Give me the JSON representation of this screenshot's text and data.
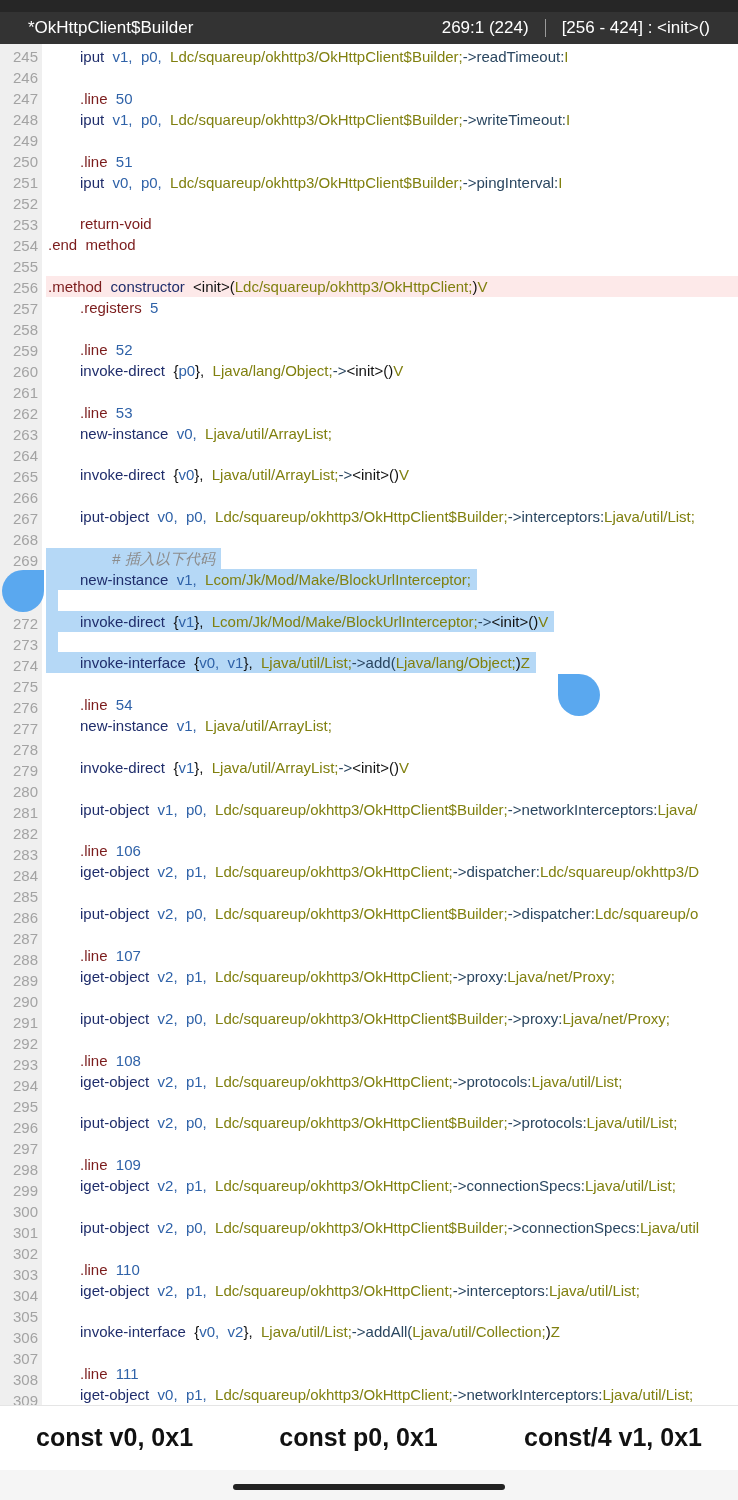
{
  "header": {
    "title": "*OkHttpClient$Builder",
    "position": "269:1 (224)",
    "range": "[256 - 424] : <init>()"
  },
  "lines": [
    {
      "number": "245",
      "kind": "code",
      "selected": false,
      "current": false,
      "tokens": [
        {
          "kind": "op",
          "text": "iput"
        },
        {
          "kind": "reg",
          "text": "  v1,"
        },
        {
          "kind": "reg",
          "text": "  p0,"
        },
        {
          "kind": "cls",
          "text": "  Ldc/squareup/okhttp3/OkHttpClient$Builder;"
        },
        {
          "kind": "mem",
          "text": "->readTimeout:"
        },
        {
          "kind": "cls",
          "text": "I"
        }
      ]
    },
    {
      "number": "246",
      "kind": "blank",
      "selected": false,
      "current": false
    },
    {
      "number": "247",
      "kind": "code",
      "selected": false,
      "current": false,
      "tokens": [
        {
          "kind": "dir",
          "text": ".line"
        },
        {
          "kind": "num",
          "text": "  50"
        }
      ]
    },
    {
      "number": "248",
      "kind": "code",
      "selected": false,
      "current": false,
      "tokens": [
        {
          "kind": "op",
          "text": "iput"
        },
        {
          "kind": "reg",
          "text": "  v1,"
        },
        {
          "kind": "reg",
          "text": "  p0,"
        },
        {
          "kind": "cls",
          "text": "  Ldc/squareup/okhttp3/OkHttpClient$Builder;"
        },
        {
          "kind": "mem",
          "text": "->writeTimeout:"
        },
        {
          "kind": "cls",
          "text": "I"
        }
      ]
    },
    {
      "number": "249",
      "kind": "blank",
      "selected": false,
      "current": false
    },
    {
      "number": "250",
      "kind": "code",
      "selected": false,
      "current": false,
      "tokens": [
        {
          "kind": "dir",
          "text": ".line"
        },
        {
          "kind": "num",
          "text": "  51"
        }
      ]
    },
    {
      "number": "251",
      "kind": "code",
      "selected": false,
      "current": false,
      "tokens": [
        {
          "kind": "op",
          "text": "iput"
        },
        {
          "kind": "reg",
          "text": "  v0,"
        },
        {
          "kind": "reg",
          "text": "  p0,"
        },
        {
          "kind": "cls",
          "text": "  Ldc/squareup/okhttp3/OkHttpClient$Builder;"
        },
        {
          "kind": "mem",
          "text": "->pingInterval:"
        },
        {
          "kind": "cls",
          "text": "I"
        }
      ]
    },
    {
      "number": "252",
      "kind": "blank",
      "selected": false,
      "current": false
    },
    {
      "number": "253",
      "kind": "code",
      "selected": false,
      "current": false,
      "tokens": [
        {
          "kind": "dir",
          "text": "return-void"
        }
      ]
    },
    {
      "number": "254",
      "kind": "decl",
      "selected": false,
      "current": false,
      "tokens": [
        {
          "kind": "dir",
          "text": ".end  method"
        }
      ]
    },
    {
      "number": "255",
      "kind": "blank",
      "selected": false,
      "current": false
    },
    {
      "number": "256",
      "kind": "decl",
      "selected": false,
      "current": true,
      "tokens": [
        {
          "kind": "dir",
          "text": ".method"
        },
        {
          "kind": "op",
          "text": "  constructor"
        },
        {
          "kind": "txt",
          "text": "  <init>("
        },
        {
          "kind": "cls",
          "text": "Ldc/squareup/okhttp3/OkHttpClient;"
        },
        {
          "kind": "txt",
          "text": ")"
        },
        {
          "kind": "cls",
          "text": "V"
        }
      ]
    },
    {
      "number": "257",
      "kind": "code",
      "selected": false,
      "current": false,
      "tokens": [
        {
          "kind": "dir",
          "text": ".registers"
        },
        {
          "kind": "num",
          "text": "  5"
        }
      ]
    },
    {
      "number": "258",
      "kind": "blank",
      "selected": false,
      "current": false
    },
    {
      "number": "259",
      "kind": "code",
      "selected": false,
      "current": false,
      "tokens": [
        {
          "kind": "dir",
          "text": ".line"
        },
        {
          "kind": "num",
          "text": "  52"
        }
      ]
    },
    {
      "number": "260",
      "kind": "code",
      "selected": false,
      "current": false,
      "tokens": [
        {
          "kind": "op",
          "text": "invoke-direct"
        },
        {
          "kind": "txt",
          "text": "  {"
        },
        {
          "kind": "reg",
          "text": "p0"
        },
        {
          "kind": "txt",
          "text": "},"
        },
        {
          "kind": "cls",
          "text": "  Ljava/lang/Object;"
        },
        {
          "kind": "mem",
          "text": "->"
        },
        {
          "kind": "txt",
          "text": "<init>()"
        },
        {
          "kind": "cls",
          "text": "V"
        }
      ]
    },
    {
      "number": "261",
      "kind": "blank",
      "selected": false,
      "current": false
    },
    {
      "number": "262",
      "kind": "code",
      "selected": false,
      "current": false,
      "tokens": [
        {
          "kind": "dir",
          "text": ".line"
        },
        {
          "kind": "num",
          "text": "  53"
        }
      ]
    },
    {
      "number": "263",
      "kind": "code",
      "selected": false,
      "current": false,
      "tokens": [
        {
          "kind": "op",
          "text": "new-instance"
        },
        {
          "kind": "reg",
          "text": "  v0,"
        },
        {
          "kind": "cls",
          "text": "  Ljava/util/ArrayList;"
        }
      ]
    },
    {
      "number": "264",
      "kind": "blank",
      "selected": false,
      "current": false
    },
    {
      "number": "265",
      "kind": "code",
      "selected": false,
      "current": false,
      "tokens": [
        {
          "kind": "op",
          "text": "invoke-direct"
        },
        {
          "kind": "txt",
          "text": "  {"
        },
        {
          "kind": "reg",
          "text": "v0"
        },
        {
          "kind": "txt",
          "text": "},"
        },
        {
          "kind": "cls",
          "text": "  Ljava/util/ArrayList;"
        },
        {
          "kind": "mem",
          "text": "->"
        },
        {
          "kind": "txt",
          "text": "<init>()"
        },
        {
          "kind": "cls",
          "text": "V"
        }
      ]
    },
    {
      "number": "266",
      "kind": "blank",
      "selected": false,
      "current": false
    },
    {
      "number": "267",
      "kind": "code",
      "selected": false,
      "current": false,
      "tokens": [
        {
          "kind": "op",
          "text": "iput-object"
        },
        {
          "kind": "reg",
          "text": "  v0,"
        },
        {
          "kind": "reg",
          "text": "  p0,"
        },
        {
          "kind": "cls",
          "text": "  Ldc/squareup/okhttp3/OkHttpClient$Builder;"
        },
        {
          "kind": "mem",
          "text": "->interceptors:"
        },
        {
          "kind": "cls",
          "text": "Ljava/util/List;"
        }
      ]
    },
    {
      "number": "268",
      "kind": "blank",
      "selected": false,
      "current": false
    },
    {
      "number": "269",
      "kind": "comment",
      "selected": true,
      "current": false,
      "tokens": [
        {
          "kind": "cmt",
          "text": "# 插入以下代码"
        }
      ]
    },
    {
      "kind": "code",
      "selected": true,
      "current": false,
      "tokens": [
        {
          "kind": "op",
          "text": "new-instance"
        },
        {
          "kind": "reg",
          "text": "  v1,"
        },
        {
          "kind": "cls",
          "text": "  Lcom/Jk/Mod/Make/BlockUrlInterceptor;"
        }
      ]
    },
    {
      "kind": "blank",
      "selected": true,
      "current": false
    },
    {
      "number": "272",
      "kind": "code",
      "selected": true,
      "current": false,
      "tokens": [
        {
          "kind": "op",
          "text": "invoke-direct"
        },
        {
          "kind": "txt",
          "text": "  {"
        },
        {
          "kind": "reg",
          "text": "v1"
        },
        {
          "kind": "txt",
          "text": "},"
        },
        {
          "kind": "cls",
          "text": "  Lcom/Jk/Mod/Make/BlockUrlInterceptor;"
        },
        {
          "kind": "mem",
          "text": "->"
        },
        {
          "kind": "txt",
          "text": "<init>()"
        },
        {
          "kind": "cls",
          "text": "V"
        }
      ]
    },
    {
      "number": "273",
      "kind": "blank",
      "selected": true,
      "current": false
    },
    {
      "number": "274",
      "kind": "code",
      "selected": true,
      "current": false,
      "tokens": [
        {
          "kind": "op",
          "text": "invoke-interface"
        },
        {
          "kind": "txt",
          "text": "  {"
        },
        {
          "kind": "reg",
          "text": "v0,"
        },
        {
          "kind": "reg",
          "text": "  v1"
        },
        {
          "kind": "txt",
          "text": "},"
        },
        {
          "kind": "cls",
          "text": "  Ljava/util/List;"
        },
        {
          "kind": "mem",
          "text": "->add("
        },
        {
          "kind": "cls",
          "text": "Ljava/lang/Object;"
        },
        {
          "kind": "txt",
          "text": ")"
        },
        {
          "kind": "cls",
          "text": "Z"
        }
      ]
    },
    {
      "number": "275",
      "kind": "blank",
      "selected": false,
      "current": false
    },
    {
      "number": "276",
      "kind": "code",
      "selected": false,
      "current": false,
      "tokens": [
        {
          "kind": "dir",
          "text": ".line"
        },
        {
          "kind": "num",
          "text": "  54"
        }
      ]
    },
    {
      "number": "277",
      "kind": "code",
      "selected": false,
      "current": false,
      "tokens": [
        {
          "kind": "op",
          "text": "new-instance"
        },
        {
          "kind": "reg",
          "text": "  v1,"
        },
        {
          "kind": "cls",
          "text": "  Ljava/util/ArrayList;"
        }
      ]
    },
    {
      "number": "278",
      "kind": "blank",
      "selected": false,
      "current": false
    },
    {
      "number": "279",
      "kind": "code",
      "selected": false,
      "current": false,
      "tokens": [
        {
          "kind": "op",
          "text": "invoke-direct"
        },
        {
          "kind": "txt",
          "text": "  {"
        },
        {
          "kind": "reg",
          "text": "v1"
        },
        {
          "kind": "txt",
          "text": "},"
        },
        {
          "kind": "cls",
          "text": "  Ljava/util/ArrayList;"
        },
        {
          "kind": "mem",
          "text": "->"
        },
        {
          "kind": "txt",
          "text": "<init>()"
        },
        {
          "kind": "cls",
          "text": "V"
        }
      ]
    },
    {
      "number": "280",
      "kind": "blank",
      "selected": false,
      "current": false
    },
    {
      "number": "281",
      "kind": "code",
      "selected": false,
      "current": false,
      "tokens": [
        {
          "kind": "op",
          "text": "iput-object"
        },
        {
          "kind": "reg",
          "text": "  v1,"
        },
        {
          "kind": "reg",
          "text": "  p0,"
        },
        {
          "kind": "cls",
          "text": "  Ldc/squareup/okhttp3/OkHttpClient$Builder;"
        },
        {
          "kind": "mem",
          "text": "->networkInterceptors:"
        },
        {
          "kind": "cls",
          "text": "Ljava/"
        }
      ]
    },
    {
      "number": "282",
      "kind": "blank",
      "selected": false,
      "current": false
    },
    {
      "number": "283",
      "kind": "code",
      "selected": false,
      "current": false,
      "tokens": [
        {
          "kind": "dir",
          "text": ".line"
        },
        {
          "kind": "num",
          "text": "  106"
        }
      ]
    },
    {
      "number": "284",
      "kind": "code",
      "selected": false,
      "current": false,
      "tokens": [
        {
          "kind": "op",
          "text": "iget-object"
        },
        {
          "kind": "reg",
          "text": "  v2,"
        },
        {
          "kind": "reg",
          "text": "  p1,"
        },
        {
          "kind": "cls",
          "text": "  Ldc/squareup/okhttp3/OkHttpClient;"
        },
        {
          "kind": "mem",
          "text": "->dispatcher:"
        },
        {
          "kind": "cls",
          "text": "Ldc/squareup/okhttp3/D"
        }
      ]
    },
    {
      "number": "285",
      "kind": "blank",
      "selected": false,
      "current": false
    },
    {
      "number": "286",
      "kind": "code",
      "selected": false,
      "current": false,
      "tokens": [
        {
          "kind": "op",
          "text": "iput-object"
        },
        {
          "kind": "reg",
          "text": "  v2,"
        },
        {
          "kind": "reg",
          "text": "  p0,"
        },
        {
          "kind": "cls",
          "text": "  Ldc/squareup/okhttp3/OkHttpClient$Builder;"
        },
        {
          "kind": "mem",
          "text": "->dispatcher:"
        },
        {
          "kind": "cls",
          "text": "Ldc/squareup/o"
        }
      ]
    },
    {
      "number": "287",
      "kind": "blank",
      "selected": false,
      "current": false
    },
    {
      "number": "288",
      "kind": "code",
      "selected": false,
      "current": false,
      "tokens": [
        {
          "kind": "dir",
          "text": ".line"
        },
        {
          "kind": "num",
          "text": "  107"
        }
      ]
    },
    {
      "number": "289",
      "kind": "code",
      "selected": false,
      "current": false,
      "tokens": [
        {
          "kind": "op",
          "text": "iget-object"
        },
        {
          "kind": "reg",
          "text": "  v2,"
        },
        {
          "kind": "reg",
          "text": "  p1,"
        },
        {
          "kind": "cls",
          "text": "  Ldc/squareup/okhttp3/OkHttpClient;"
        },
        {
          "kind": "mem",
          "text": "->proxy:"
        },
        {
          "kind": "cls",
          "text": "Ljava/net/Proxy;"
        }
      ]
    },
    {
      "number": "290",
      "kind": "blank",
      "selected": false,
      "current": false
    },
    {
      "number": "291",
      "kind": "code",
      "selected": false,
      "current": false,
      "tokens": [
        {
          "kind": "op",
          "text": "iput-object"
        },
        {
          "kind": "reg",
          "text": "  v2,"
        },
        {
          "kind": "reg",
          "text": "  p0,"
        },
        {
          "kind": "cls",
          "text": "  Ldc/squareup/okhttp3/OkHttpClient$Builder;"
        },
        {
          "kind": "mem",
          "text": "->proxy:"
        },
        {
          "kind": "cls",
          "text": "Ljava/net/Proxy;"
        }
      ]
    },
    {
      "number": "292",
      "kind": "blank",
      "selected": false,
      "current": false
    },
    {
      "number": "293",
      "kind": "code",
      "selected": false,
      "current": false,
      "tokens": [
        {
          "kind": "dir",
          "text": ".line"
        },
        {
          "kind": "num",
          "text": "  108"
        }
      ]
    },
    {
      "number": "294",
      "kind": "code",
      "selected": false,
      "current": false,
      "tokens": [
        {
          "kind": "op",
          "text": "iget-object"
        },
        {
          "kind": "reg",
          "text": "  v2,"
        },
        {
          "kind": "reg",
          "text": "  p1,"
        },
        {
          "kind": "cls",
          "text": "  Ldc/squareup/okhttp3/OkHttpClient;"
        },
        {
          "kind": "mem",
          "text": "->protocols:"
        },
        {
          "kind": "cls",
          "text": "Ljava/util/List;"
        }
      ]
    },
    {
      "number": "295",
      "kind": "blank",
      "selected": false,
      "current": false
    },
    {
      "number": "296",
      "kind": "code",
      "selected": false,
      "current": false,
      "tokens": [
        {
          "kind": "op",
          "text": "iput-object"
        },
        {
          "kind": "reg",
          "text": "  v2,"
        },
        {
          "kind": "reg",
          "text": "  p0,"
        },
        {
          "kind": "cls",
          "text": "  Ldc/squareup/okhttp3/OkHttpClient$Builder;"
        },
        {
          "kind": "mem",
          "text": "->protocols:"
        },
        {
          "kind": "cls",
          "text": "Ljava/util/List;"
        }
      ]
    },
    {
      "number": "297",
      "kind": "blank",
      "selected": false,
      "current": false
    },
    {
      "number": "298",
      "kind": "code",
      "selected": false,
      "current": false,
      "tokens": [
        {
          "kind": "dir",
          "text": ".line"
        },
        {
          "kind": "num",
          "text": "  109"
        }
      ]
    },
    {
      "number": "299",
      "kind": "code",
      "selected": false,
      "current": false,
      "tokens": [
        {
          "kind": "op",
          "text": "iget-object"
        },
        {
          "kind": "reg",
          "text": "  v2,"
        },
        {
          "kind": "reg",
          "text": "  p1,"
        },
        {
          "kind": "cls",
          "text": "  Ldc/squareup/okhttp3/OkHttpClient;"
        },
        {
          "kind": "mem",
          "text": "->connectionSpecs:"
        },
        {
          "kind": "cls",
          "text": "Ljava/util/List;"
        }
      ]
    },
    {
      "number": "300",
      "kind": "blank",
      "selected": false,
      "current": false
    },
    {
      "number": "301",
      "kind": "code",
      "selected": false,
      "current": false,
      "tokens": [
        {
          "kind": "op",
          "text": "iput-object"
        },
        {
          "kind": "reg",
          "text": "  v2,"
        },
        {
          "kind": "reg",
          "text": "  p0,"
        },
        {
          "kind": "cls",
          "text": "  Ldc/squareup/okhttp3/OkHttpClient$Builder;"
        },
        {
          "kind": "mem",
          "text": "->connectionSpecs:"
        },
        {
          "kind": "cls",
          "text": "Ljava/util"
        }
      ]
    },
    {
      "number": "302",
      "kind": "blank",
      "selected": false,
      "current": false
    },
    {
      "number": "303",
      "kind": "code",
      "selected": false,
      "current": false,
      "tokens": [
        {
          "kind": "dir",
          "text": ".line"
        },
        {
          "kind": "num",
          "text": "  110"
        }
      ]
    },
    {
      "number": "304",
      "kind": "code",
      "selected": false,
      "current": false,
      "tokens": [
        {
          "kind": "op",
          "text": "iget-object"
        },
        {
          "kind": "reg",
          "text": "  v2,"
        },
        {
          "kind": "reg",
          "text": "  p1,"
        },
        {
          "kind": "cls",
          "text": "  Ldc/squareup/okhttp3/OkHttpClient;"
        },
        {
          "kind": "mem",
          "text": "->interceptors:"
        },
        {
          "kind": "cls",
          "text": "Ljava/util/List;"
        }
      ]
    },
    {
      "number": "305",
      "kind": "blank",
      "selected": false,
      "current": false
    },
    {
      "number": "306",
      "kind": "code",
      "selected": false,
      "current": false,
      "tokens": [
        {
          "kind": "op",
          "text": "invoke-interface"
        },
        {
          "kind": "txt",
          "text": "  {"
        },
        {
          "kind": "reg",
          "text": "v0,"
        },
        {
          "kind": "reg",
          "text": "  v2"
        },
        {
          "kind": "txt",
          "text": "},"
        },
        {
          "kind": "cls",
          "text": "  Ljava/util/List;"
        },
        {
          "kind": "mem",
          "text": "->addAll("
        },
        {
          "kind": "cls",
          "text": "Ljava/util/Collection;"
        },
        {
          "kind": "txt",
          "text": ")"
        },
        {
          "kind": "cls",
          "text": "Z"
        }
      ]
    },
    {
      "number": "307",
      "kind": "blank",
      "selected": false,
      "current": false
    },
    {
      "number": "308",
      "kind": "code",
      "selected": false,
      "current": false,
      "tokens": [
        {
          "kind": "dir",
          "text": ".line"
        },
        {
          "kind": "num",
          "text": "  111"
        }
      ]
    },
    {
      "number": "309",
      "kind": "code",
      "selected": false,
      "current": false,
      "tokens": [
        {
          "kind": "op",
          "text": "iget-object"
        },
        {
          "kind": "reg",
          "text": "  v0,"
        },
        {
          "kind": "reg",
          "text": "  p1,"
        },
        {
          "kind": "cls",
          "text": "  Ldc/squareup/okhttp3/OkHttpClient;"
        },
        {
          "kind": "mem",
          "text": "->networkInterceptors:"
        },
        {
          "kind": "cls",
          "text": "Ljava/util/List;"
        }
      ]
    }
  ],
  "quick_inputs": [
    "const v0, 0x1",
    "const p0, 0x1",
    "const/4 v1, 0x1"
  ]
}
